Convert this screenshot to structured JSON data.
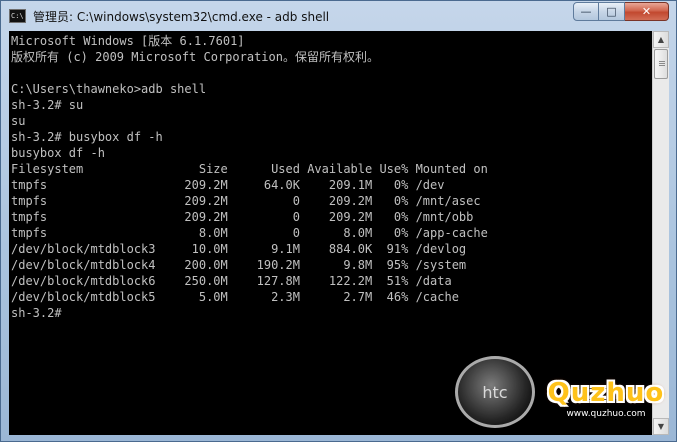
{
  "window": {
    "title": "管理员: C:\\windows\\system32\\cmd.exe - adb  shell",
    "icon_label": "C:\\"
  },
  "controls": {
    "minimize": "—",
    "maximize": "□",
    "close": "✕"
  },
  "console": {
    "lines": [
      "Microsoft Windows [版本 6.1.7601]",
      "版权所有 (c) 2009 Microsoft Corporation。保留所有权利。",
      "",
      "C:\\Users\\thawneko>adb shell",
      "sh-3.2# su",
      "su",
      "sh-3.2# busybox df -h",
      "busybox df -h",
      "Filesystem                Size      Used Available Use% Mounted on",
      "tmpfs                   209.2M     64.0K    209.1M   0% /dev",
      "tmpfs                   209.2M         0    209.2M   0% /mnt/asec",
      "tmpfs                   209.2M         0    209.2M   0% /mnt/obb",
      "tmpfs                     8.0M         0      8.0M   0% /app-cache",
      "/dev/block/mtdblock3     10.0M      9.1M    884.0K  91% /devlog",
      "/dev/block/mtdblock4    200.0M    190.2M      9.8M  95% /system",
      "/dev/block/mtdblock6    250.0M    127.8M    122.2M  51% /data",
      "/dev/block/mtdblock5      5.0M      2.3M      2.7M  46% /cache",
      "sh-3.2#"
    ]
  },
  "scrollbar": {
    "up_arrow": "▲",
    "down_arrow": "▼"
  },
  "watermarks": {
    "htc_logo": "htc",
    "brand": "Quzhuo",
    "url": "www.quzhuo.com"
  },
  "colors": {
    "console_bg": "#000000",
    "console_fg": "#c0c0c0",
    "close_button": "#c2482f",
    "brand": "#ffc21a"
  }
}
